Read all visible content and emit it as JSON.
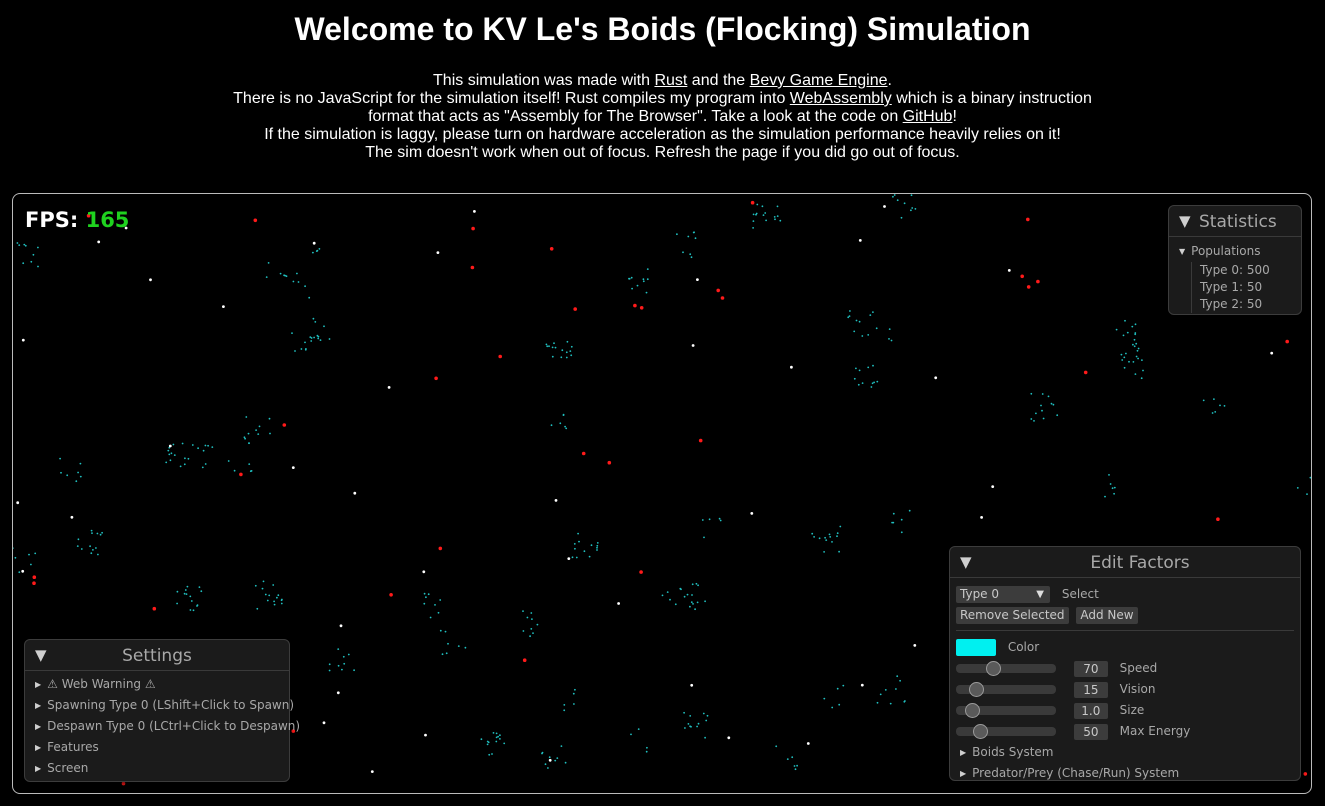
{
  "header": {
    "title": "Welcome to KV Le's Boids (Flocking) Simulation",
    "line1_pre": "This simulation was made with ",
    "line1_link1": "Rust",
    "line1_mid": " and the ",
    "line1_link2": "Bevy Game Engine",
    "line1_post": ".",
    "line2_pre": "There is no JavaScript for the simulation itself! Rust compiles my program into ",
    "line2_link": "WebAssembly",
    "line2_post": " which is a binary instruction",
    "line3_pre": "format that acts as \"Assembly for The Browser\". Take a look at the code on ",
    "line3_link": "GitHub",
    "line3_post": "!",
    "line4": "If the simulation is laggy, please turn on hardware acceleration as the simulation performance heavily relies on it!",
    "line5": "The sim doesn't work when out of focus. Refresh the page if you did go out of focus."
  },
  "fps": {
    "label": "FPS:",
    "value": "165"
  },
  "statistics": {
    "title": "Statistics",
    "group": "Populations",
    "items": [
      "Type 0: 500",
      "Type 1: 50",
      "Type 2: 50"
    ]
  },
  "settings": {
    "title": "Settings",
    "items": [
      "⚠ Web Warning ⚠",
      "Spawning Type 0 (LShift+Click to Spawn)",
      "Despawn Type 0 (LCtrl+Click to Despawn)",
      "Features",
      "Screen"
    ]
  },
  "edit_factors": {
    "title": "Edit Factors",
    "type_selected": "Type 0",
    "select_label": "Select",
    "remove_button": "Remove Selected",
    "add_button": "Add New",
    "color_label": "Color",
    "color_value": "#00f0f0",
    "sliders": [
      {
        "label": "Speed",
        "value": "70",
        "fraction": 0.35
      },
      {
        "label": "Vision",
        "value": "15",
        "fraction": 0.15
      },
      {
        "label": "Size",
        "value": "1.0",
        "fraction": 0.1
      },
      {
        "label": "Max Energy",
        "value": "50",
        "fraction": 0.2
      }
    ],
    "sections": [
      "Boids System",
      "Predator/Prey (Chase/Run) System"
    ]
  },
  "colors": {
    "fps_value": "#1fd21f",
    "type0": "#20c0c0",
    "type1": "#ffffff",
    "type2": "#ff1a1a"
  }
}
